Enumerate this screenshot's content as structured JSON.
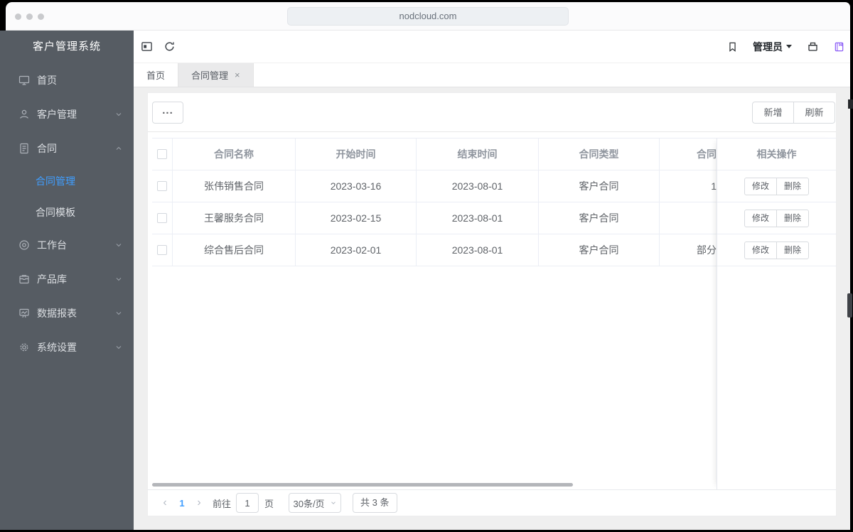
{
  "browser": {
    "url": "nodcloud.com"
  },
  "sidebar": {
    "title": "客户管理系统",
    "items": [
      {
        "label": "首页"
      },
      {
        "label": "客户管理"
      },
      {
        "label": "合同"
      },
      {
        "label": "合同管理"
      },
      {
        "label": "合同模板"
      },
      {
        "label": "工作台"
      },
      {
        "label": "产品库"
      },
      {
        "label": "数据报表"
      },
      {
        "label": "系统设置"
      }
    ]
  },
  "topbar": {
    "admin_label": "管理员"
  },
  "tabs": {
    "home": "首页",
    "active": "合同管理",
    "close": "×"
  },
  "panel": {
    "more_label": "...",
    "add_label": "新增",
    "refresh_label": "刷新"
  },
  "table": {
    "headers": {
      "name": "合同名称",
      "start": "开始时间",
      "end": "结束时间",
      "type": "合同类型",
      "extra": "合同",
      "actions": "相关操作"
    },
    "rows": [
      {
        "name": "张伟销售合同",
        "start": "2023-03-16",
        "end": "2023-08-01",
        "type": "客户合同",
        "extra": "1"
      },
      {
        "name": "王馨服务合同",
        "start": "2023-02-15",
        "end": "2023-08-01",
        "type": "客户合同",
        "extra": ""
      },
      {
        "name": "综合售后合同",
        "start": "2023-02-01",
        "end": "2023-08-01",
        "type": "客户合同",
        "extra": "部分"
      }
    ],
    "edit_label": "修改",
    "delete_label": "删除"
  },
  "pagination": {
    "prev": "‹",
    "page": "1",
    "next": "›",
    "goto_label": "前往",
    "goto_value": "1",
    "unit_label": "页",
    "page_size": "30条/页",
    "total": "共 3 条"
  },
  "colors": {
    "accent": "#409eff",
    "sidebar_bg": "#565c63",
    "purple": "#8b5cf6"
  }
}
